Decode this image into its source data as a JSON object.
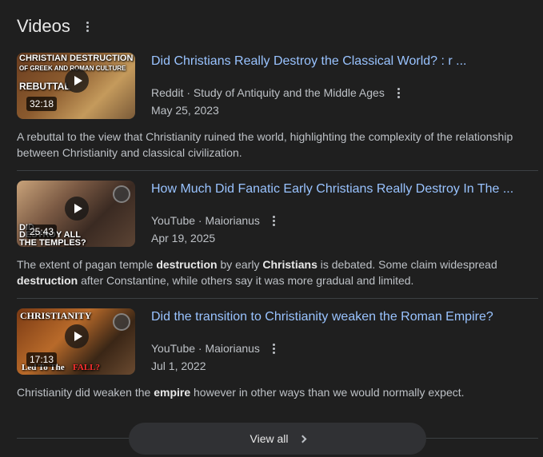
{
  "section": {
    "title": "Videos"
  },
  "videos": [
    {
      "title": "Did Christians Really Destroy the Classical World? : r ...",
      "source": "Reddit · Study of Antiquity and the Middle Ages",
      "date": "May 25, 2023",
      "duration": "32:18",
      "thumb_text": [
        "CHRISTIAN DESTRUCTION",
        "OF GREEK AND ROMAN CULTURE",
        "REBUTTAL"
      ],
      "desc_parts": [
        {
          "t": "A rebuttal to the view that Christianity ruined the world, highlighting the complexity of the relationship between Christianity and classical civilization.",
          "b": false
        }
      ]
    },
    {
      "title": "How Much Did Fanatic Early Christians Really Destroy In The ...",
      "source": "YouTube · Maiorianus",
      "date": "Apr 19, 2025",
      "duration": "25:43",
      "thumb_text": [
        "DID",
        "DESTROY ALL",
        "THE TEMPLES?"
      ],
      "desc_parts": [
        {
          "t": "The extent of pagan temple ",
          "b": false
        },
        {
          "t": "destruction",
          "b": true
        },
        {
          "t": " by early ",
          "b": false
        },
        {
          "t": "Christians",
          "b": true
        },
        {
          "t": " is debated. Some claim widespread ",
          "b": false
        },
        {
          "t": "destruction",
          "b": true
        },
        {
          "t": " after Constantine, while others say it was more gradual and limited.",
          "b": false
        }
      ]
    },
    {
      "title": "Did the transition to Christianity weaken the Roman Empire?",
      "source": "YouTube · Maiorianus",
      "date": "Jul 1, 2022",
      "duration": "17:13",
      "thumb_text": [
        "CHRISTIANITY",
        "Led To The",
        "FALL?"
      ],
      "desc_parts": [
        {
          "t": "Christianity did weaken the ",
          "b": false
        },
        {
          "t": "empire",
          "b": true
        },
        {
          "t": " however in other ways than we would normally expect.",
          "b": false
        }
      ]
    }
  ],
  "view_all": {
    "label": "View all"
  }
}
